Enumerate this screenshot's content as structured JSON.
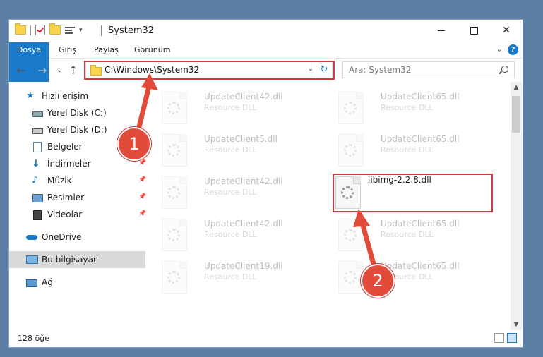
{
  "window": {
    "title": "System32",
    "controls": {
      "minimize": "minimize",
      "maximize": "maximize",
      "close": "✕"
    }
  },
  "ribbon": {
    "tabs": [
      "Dosya",
      "Giriş",
      "Paylaş",
      "Görünüm"
    ]
  },
  "nav": {
    "back": "←",
    "forward": "→",
    "recent": "⌄",
    "up": "↑",
    "address": "C:\\Windows\\System32",
    "refresh": "↻",
    "search_placeholder": "Ara: System32"
  },
  "sidebar": {
    "items": [
      {
        "label": "Hızlı erişim",
        "icon": "star-icon"
      },
      {
        "label": "Yerel Disk (C:)",
        "icon": "drive-icon"
      },
      {
        "label": "Yerel Disk (D:)",
        "icon": "drive-icon"
      },
      {
        "label": "Belgeler",
        "icon": "document-icon"
      },
      {
        "label": "İndirmeler",
        "icon": "download-icon",
        "pinned": true
      },
      {
        "label": "Müzik",
        "icon": "music-icon",
        "pinned": true
      },
      {
        "label": "Resimler",
        "icon": "pictures-icon",
        "pinned": true
      },
      {
        "label": "Videolar",
        "icon": "video-icon",
        "pinned": true
      },
      {
        "label": "OneDrive",
        "icon": "cloud-icon"
      },
      {
        "label": "Bu bilgisayar",
        "icon": "computer-icon",
        "selected": true
      },
      {
        "label": "Ağ",
        "icon": "network-icon"
      }
    ]
  },
  "files": [
    {
      "name": "UpdateClient42.dll",
      "type": "Resource DLL"
    },
    {
      "name": "UpdateClient65.dll",
      "type": "Resource DLL"
    },
    {
      "name": "UpdateClient5.dll",
      "type": "Resource DLL"
    },
    {
      "name": "UpdateClient65.dll",
      "type": "Resource DLL"
    },
    {
      "name": "UpdateClient42.dll",
      "type": "Resource DLL"
    },
    {
      "name": "libimg-2.2.8.dll",
      "type": ""
    },
    {
      "name": "UpdateClient42.dll",
      "type": "Resource DLL"
    },
    {
      "name": "UpdateClient65.dll",
      "type": "Resource DLL"
    },
    {
      "name": "UpdateClient19.dll",
      "type": "Resource DLL"
    },
    {
      "name": "UpdateClient65.dll",
      "type": "Resource DLL"
    }
  ],
  "status": {
    "count": "128 öğe"
  },
  "annotations": {
    "step1": "1",
    "step2": "2",
    "color": "#e24b3a"
  }
}
